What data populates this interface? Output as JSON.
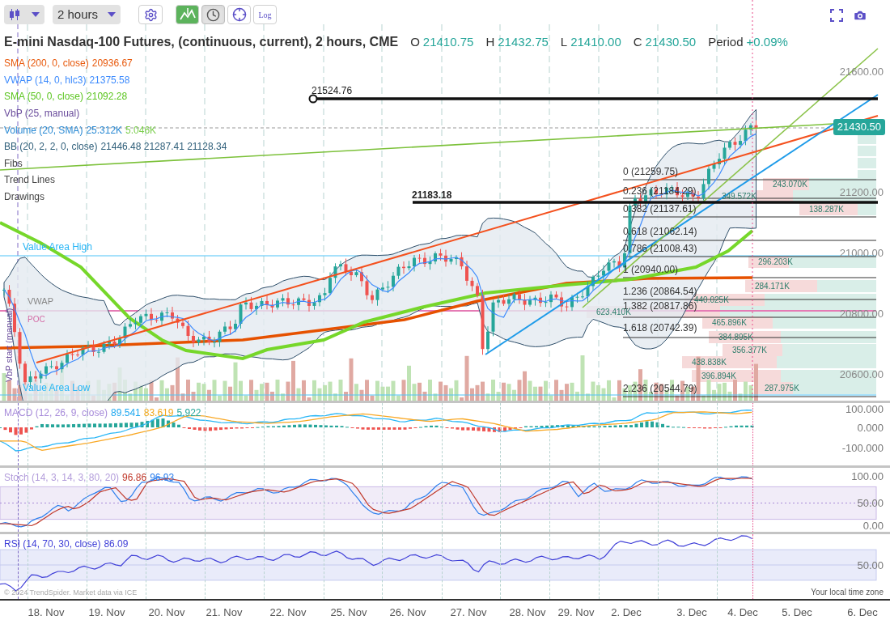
{
  "toolbar": {
    "interval": "2 hours",
    "tools": [
      {
        "selected": true,
        "pressed": false
      },
      {
        "selected": false,
        "pressed": true
      },
      {
        "selected": false,
        "pressed": false
      },
      {
        "selected": false,
        "pressed": false,
        "label": "Log"
      }
    ]
  },
  "title": "E-mini Nasdaq-100 Futures, (continuous, current), 2 hours, CME",
  "ohlc": [
    {
      "label": "O",
      "value": "21410.75"
    },
    {
      "label": "H",
      "value": "21432.75"
    },
    {
      "label": "L",
      "value": "21410.00"
    },
    {
      "label": "C",
      "value": "21430.50"
    },
    {
      "label": "Period",
      "value": "+0.09%"
    }
  ],
  "legend": [
    {
      "name": "SMA (200, 0, close)",
      "color": "#e8590c",
      "values": [
        {
          "text": "20936.67",
          "color": "#e8590c"
        }
      ]
    },
    {
      "name": "VWAP (14, 0, hlc3)",
      "color": "#3d8bfd",
      "values": [
        {
          "text": "21375.58",
          "color": "#3d8bfd"
        }
      ]
    },
    {
      "name": "SMA (50, 0, close)",
      "color": "#5cc520",
      "values": [
        {
          "text": "21092.28",
          "color": "#5cc520"
        }
      ]
    },
    {
      "name": "VbP (25, manual)",
      "color": "#6a4c9c"
    },
    {
      "name": "Volume (20, SMA)",
      "color": "#2a8ad4",
      "values": [
        {
          "text": "25.312K",
          "color": "#2a8ad4"
        },
        {
          "text": "5.046K",
          "color": "#7ccf4f"
        }
      ]
    },
    {
      "name": "BB (20, 2, 2, 0, close)",
      "color": "#2f5f7a",
      "values": [
        {
          "text": "21446.48 21287.41 21128.34",
          "color": "#2f5f7a"
        }
      ]
    }
  ],
  "groups": [
    "Fibs",
    "Trend Lines",
    "Drawings"
  ],
  "chart": {
    "price_axis": [
      "21600.00",
      "21200.00",
      "21000.00",
      "20800.00",
      "20600.00"
    ],
    "last_price": "21430.50",
    "levels": [
      "21524.76",
      "21183.18"
    ],
    "fibs": [
      "0 (21259.75)",
      "0.236 (21184.29)",
      "0.382 (21137.61)",
      "0.618 (21062.14)",
      "0.786 (21008.43)",
      "1 (20940.00)",
      "1.236 (20864.54)",
      "1.382 (20817.86)",
      "1.618 (20742.39)",
      "2.236 (20544.79)"
    ],
    "volume_profile": [
      "243.070K",
      "349.572K",
      "138.287K",
      "296.203K",
      "284.171K",
      "440.025K",
      "623.410K",
      "465.896K",
      "384.895K",
      "356.377K",
      "438.838K",
      "396.894K",
      "287.975K"
    ],
    "vbp_labels": {
      "value_area_high": "Value Area High",
      "vwap": "VWAP",
      "poc": "POC",
      "value_area_low": "Value Area Low",
      "start": "VbP start (manual)"
    }
  },
  "panes": [
    {
      "kind": "macd",
      "name": "MACD (12, 26, 9, close)",
      "color": "#a78bda",
      "values": [
        {
          "text": "89.541",
          "color": "#1fa8f0"
        },
        {
          "text": "83.619",
          "color": "#f2a81d"
        },
        {
          "text": "5.922",
          "color": "#26a69a"
        }
      ],
      "axis": [
        "100.000",
        "0.000",
        "-100.000"
      ]
    },
    {
      "kind": "stoch",
      "name": "Stoch (14, 3, 14, 3, 80, 20)",
      "color": "#b39ddb",
      "values": [
        {
          "text": "96.86",
          "color": "#c0392b"
        },
        {
          "text": "96.93",
          "color": "#2f80ed"
        }
      ],
      "axis": [
        "100.00",
        "50.00",
        "0.00"
      ]
    },
    {
      "kind": "rsi",
      "name": "RSI (14, 70, 30, close)",
      "color": "#3f3fd8",
      "values": [
        {
          "text": "86.09",
          "color": "#3f3fd8"
        }
      ],
      "axis": [
        "50.00"
      ]
    }
  ],
  "copyright": "© 2024 TrendSpider. Market data via ICE",
  "timezone": "Your local time zone",
  "x_axis": [
    "18. Nov",
    "19. Nov",
    "20. Nov",
    "21. Nov",
    "22. Nov",
    "25. Nov",
    "26. Nov",
    "27. Nov",
    "28. Nov",
    "29. Nov",
    "2. Dec",
    "3. Dec",
    "4. Dec",
    "5. Dec",
    "6. Dec"
  ]
}
